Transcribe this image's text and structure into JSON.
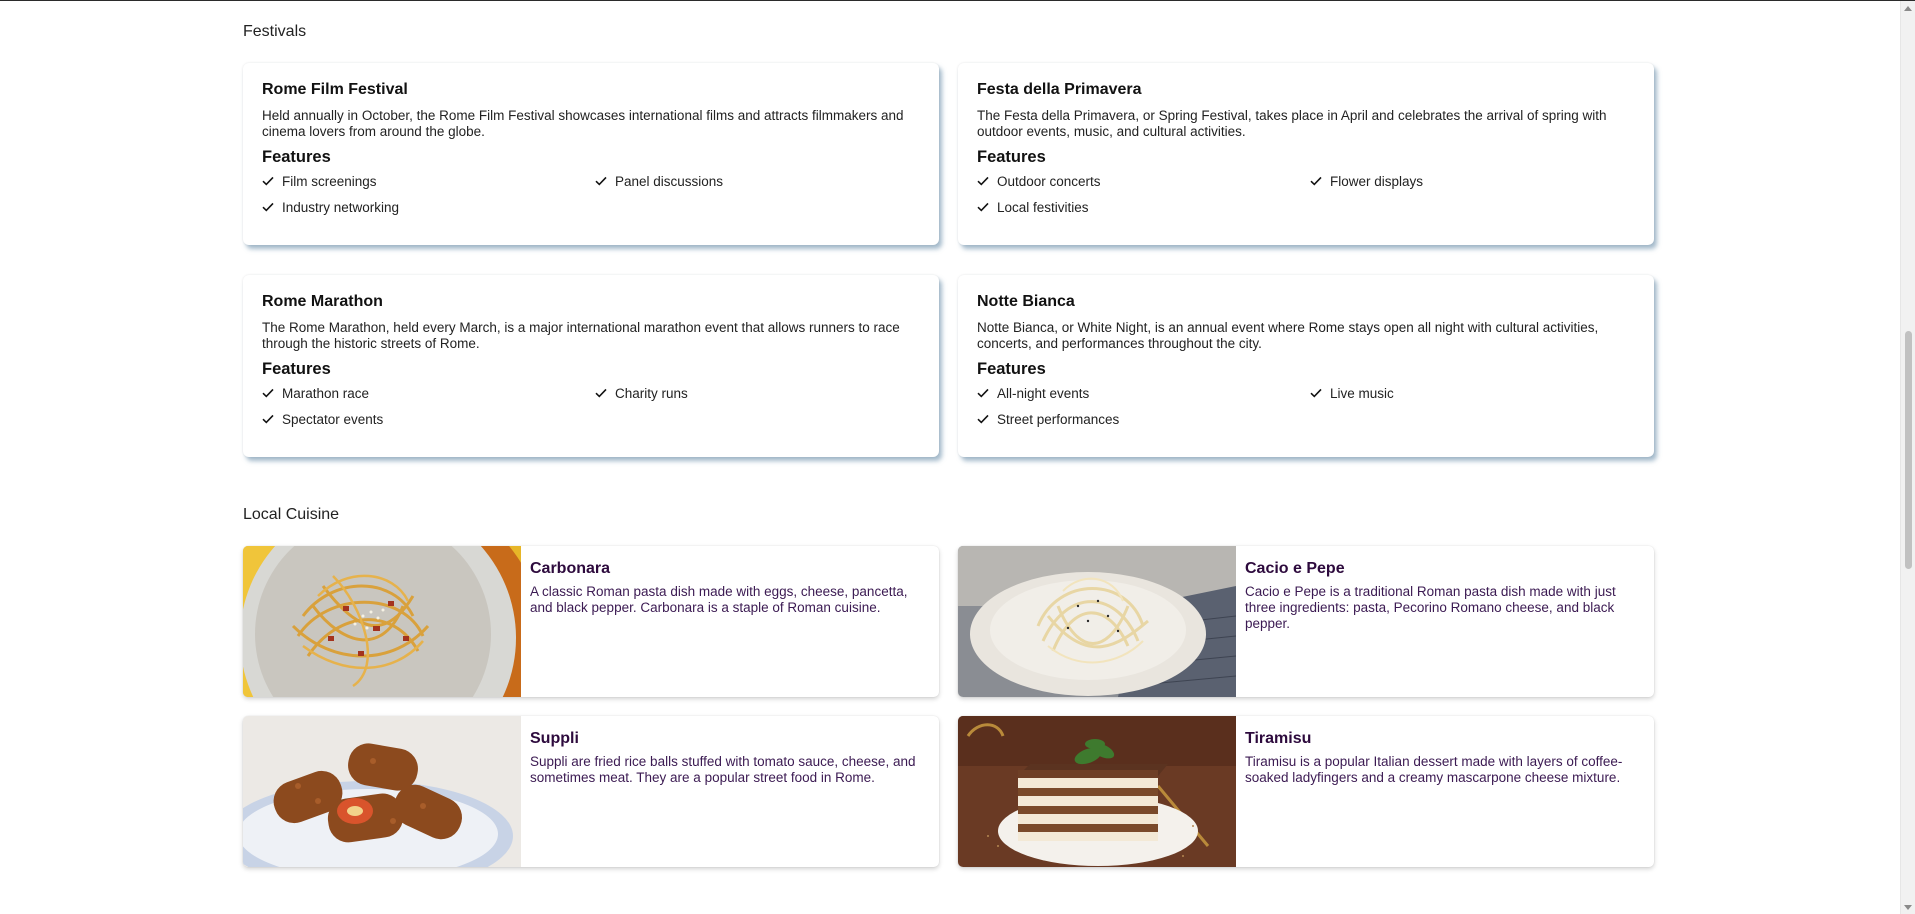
{
  "festivals": {
    "title": "Festivals",
    "features_heading": "Features",
    "cards": [
      {
        "name": "Rome Film Festival",
        "description": "Held annually in October, the Rome Film Festival showcases international films and attracts filmmakers and cinema lovers from around the globe.",
        "features": [
          "Film screenings",
          "Panel discussions",
          "Industry networking"
        ]
      },
      {
        "name": "Festa della Primavera",
        "description": "The Festa della Primavera, or Spring Festival, takes place in April and celebrates the arrival of spring with outdoor events, music, and cultural activities.",
        "features": [
          "Outdoor concerts",
          "Flower displays",
          "Local festivities"
        ]
      },
      {
        "name": "Rome Marathon",
        "description": "The Rome Marathon, held every March, is a major international marathon event that allows runners to race through the historic streets of Rome.",
        "features": [
          "Marathon race",
          "Charity runs",
          "Spectator events"
        ]
      },
      {
        "name": "Notte Bianca",
        "description": "Notte Bianca, or White Night, is an annual event where Rome stays open all night with cultural activities, concerts, and performances throughout the city.",
        "features": [
          "All-night events",
          "Live music",
          "Street performances"
        ]
      }
    ]
  },
  "cuisine": {
    "title": "Local Cuisine",
    "cards": [
      {
        "name": "Carbonara",
        "description": "A classic Roman pasta dish made with eggs, cheese, pancetta, and black pepper. Carbonara is a staple of Roman cuisine."
      },
      {
        "name": "Cacio e Pepe",
        "description": "Cacio e Pepe is a traditional Roman pasta dish made with just three ingredients: pasta, Pecorino Romano cheese, and black pepper."
      },
      {
        "name": "Suppli",
        "description": "Suppli are fried rice balls stuffed with tomato sauce, cheese, and sometimes meat. They are a popular street food in Rome."
      },
      {
        "name": "Tiramisu",
        "description": "Tiramisu is a popular Italian dessert made with layers of coffee-soaked ladyfingers and a creamy mascarpone cheese mixture."
      }
    ]
  },
  "colors": {
    "card_shadow": "#5a82a0",
    "food_title": "#2d0a3d",
    "food_text": "#3b1a52"
  }
}
